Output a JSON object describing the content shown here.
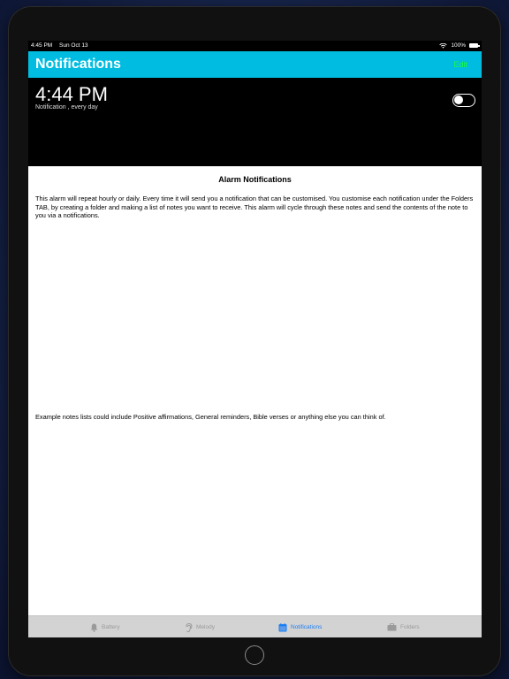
{
  "status_bar": {
    "time": "4:45 PM",
    "date": "Sun Oct 13",
    "battery": "100%"
  },
  "nav": {
    "title": "Notifications",
    "edit_label": "Edit"
  },
  "alarm": {
    "time": "4:44 PM",
    "subtitle": "Notification , every day",
    "enabled": false
  },
  "content": {
    "heading": "Alarm Notifications",
    "paragraph1": "This alarm will repeat hourly or daily. Every time it will send you a notification that can be customised.  You customise each notification under the Folders TAB, by creating a folder and making a list of notes you want to receive.  This alarm will cycle through these notes and send the contents of the note to you via a notifications.",
    "paragraph2": "Example notes lists could include Positive affirmations, General reminders, Bible verses or anything else you can think of."
  },
  "tabs": [
    {
      "label": "Battery",
      "icon": "bell-icon",
      "active": false
    },
    {
      "label": "Melody",
      "icon": "ear-icon",
      "active": false
    },
    {
      "label": "Notifications",
      "icon": "calendar-icon",
      "active": true
    },
    {
      "label": "Folders",
      "icon": "briefcase-icon",
      "active": false
    }
  ],
  "colors": {
    "nav_background": "#00bce0",
    "edit_text": "#1aff3b",
    "active_tab": "#1c7ef5",
    "inactive_tab": "#9a9a9a"
  }
}
